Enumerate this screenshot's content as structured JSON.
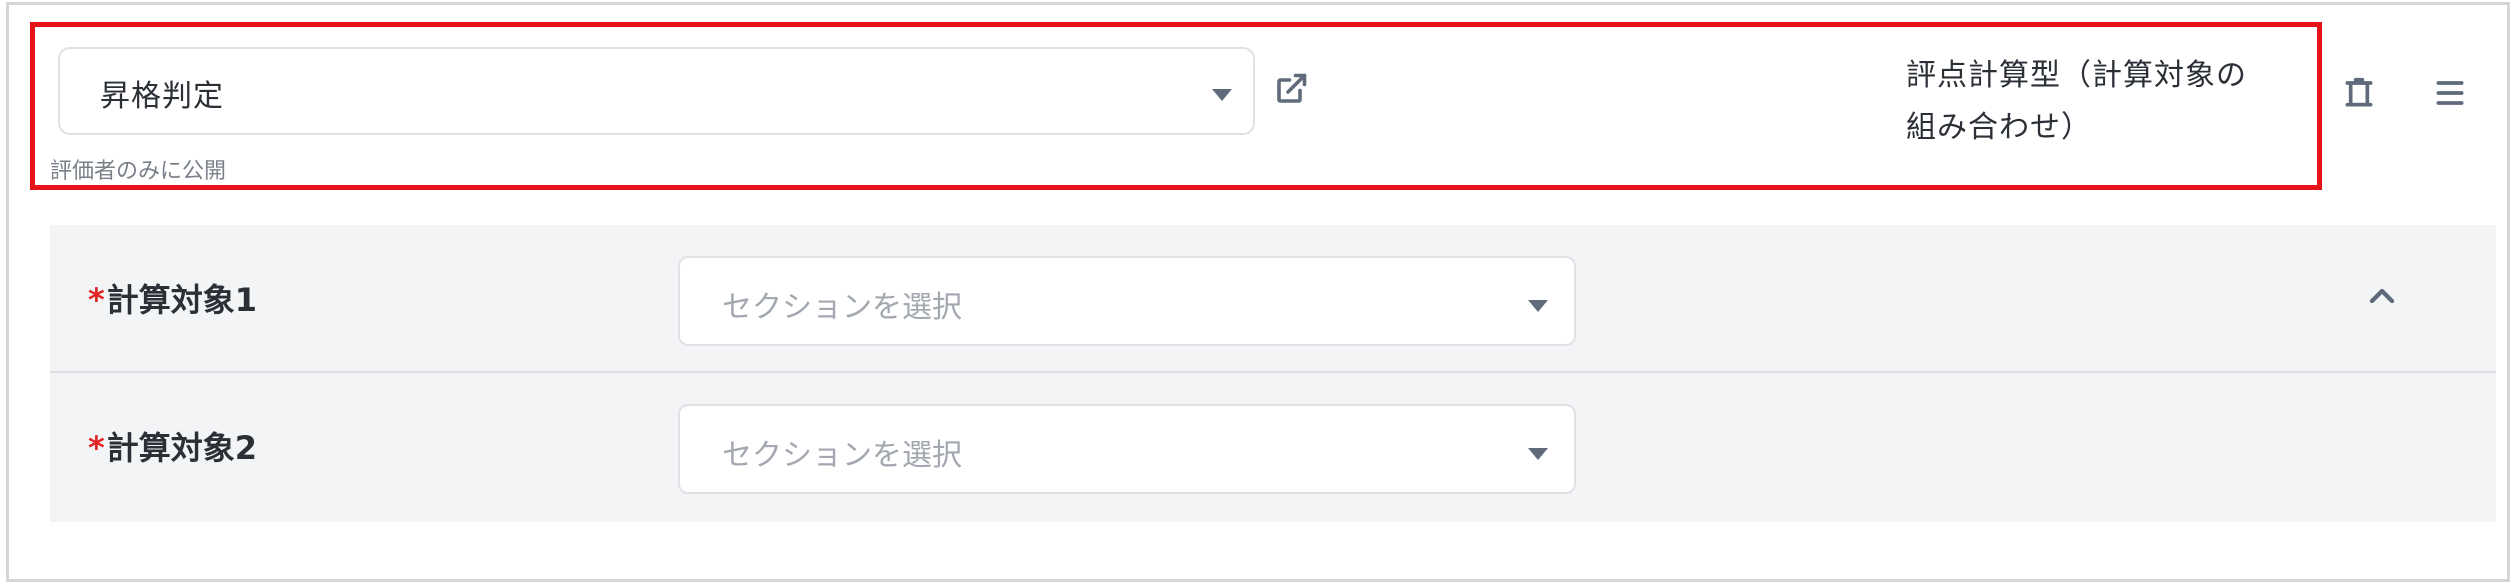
{
  "header": {
    "select_value": "昇格判定",
    "visibility_note": "評価者のみに公開",
    "type_label_line1": "評点計算型（計算対象の",
    "type_label_line2": "組み合わせ）"
  },
  "rows": [
    {
      "required_mark": "*",
      "label": "計算対象1",
      "placeholder": "セクションを選択"
    },
    {
      "required_mark": "*",
      "label": "計算対象2",
      "placeholder": "セクションを選択"
    }
  ],
  "icons": {
    "open_external": "external-link-icon",
    "delete": "trash-icon",
    "menu": "hamburger-menu-icon",
    "collapse": "chevron-up-icon",
    "dropdown": "caret-down-icon"
  },
  "colors": {
    "highlight_border": "#e8141c",
    "required": "#e02424",
    "section_bg": "#f3f4f6",
    "icon": "#5f6a7a"
  }
}
